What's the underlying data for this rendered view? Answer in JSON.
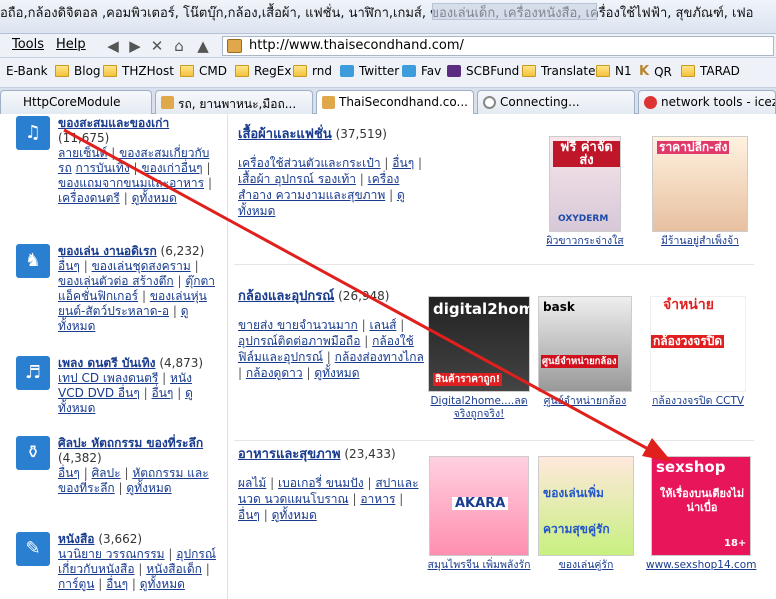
{
  "titlebar": {
    "title": "อถือ,กล้องดิจิตอล ,คอมพิวเตอร์, โน๊ตบุ๊ก,กล้อง,เสื้อผ้า, แฟชั่น, นาฬิกา,เกมส์, ของเล่นเด็ก, เครื่องหนังสือ, เครื่องใช้ไฟฟ้า, สุขภัณฑ์, เฟอ"
  },
  "menu": {
    "tools": "Tools",
    "help": "Help"
  },
  "address": {
    "url": "http://www.thaisecondhand.com/"
  },
  "bookmarks": [
    {
      "label": "E-Bank",
      "icon": "folder-icon"
    },
    {
      "label": "Blog",
      "icon": "folder-icon"
    },
    {
      "label": "THZHost",
      "icon": "folder-icon"
    },
    {
      "label": "CMD",
      "icon": "folder-icon"
    },
    {
      "label": "RegEx",
      "icon": "folder-icon"
    },
    {
      "label": "rnd",
      "icon": "folder-icon"
    },
    {
      "label": "Twitter",
      "icon": "twitter-icon"
    },
    {
      "label": "Fav",
      "icon": "bird-icon"
    },
    {
      "label": "SCBFund",
      "icon": "scb-icon"
    },
    {
      "label": "Translate",
      "icon": "folder-icon"
    },
    {
      "label": "N1",
      "icon": "folder-icon"
    },
    {
      "label": "QR",
      "icon": "k-icon"
    },
    {
      "label": "TARAD",
      "icon": "folder-icon"
    }
  ],
  "tabs": [
    {
      "label": "HttpCoreModule"
    },
    {
      "label": "รถ, ยานพาหนะ,มือถ..."
    },
    {
      "label": "ThaiSecondhand.co..."
    },
    {
      "label": "Connecting..."
    },
    {
      "label": "network tools - icez"
    }
  ],
  "categories": [
    {
      "title": "ของสะสมและของเก่า",
      "count": "(11,675)",
      "links": [
        "ลายเซ็นต์",
        "ของสะสมเกี่ยวกับรถ",
        "การบันเทิง",
        "ของเก่าอื่นๆ",
        "ของแถมจากขนมและอาหาร",
        "เครื่องดนตรี",
        "ดูทั้งหมด"
      ]
    },
    {
      "title": "ของเล่น งานอดิเรก",
      "count": "(6,232)",
      "links": [
        "อื่นๆ",
        "ของเล่นชุดสงคราม",
        "ของเล่นตัวต่อ สร้างตึก",
        "ตุ๊กตาแอ็คชั่นฟิกเกอร์",
        "ของเล่นหุ่นยนต์-สัตว์ประหลาด-อ",
        "ดูทั้งหมด"
      ]
    },
    {
      "title": "เพลง ดนตรี บันเทิง",
      "count": "(4,873)",
      "links": [
        "เทป CD เพลงดนตรี",
        "หนัง VCD DVD อื่นๆ",
        "อื่นๆ",
        "ดูทั้งหมด"
      ]
    },
    {
      "title": "ศิลปะ หัตถกรรม ของที่ระลึก",
      "count": "(4,382)",
      "links": [
        "อื่นๆ",
        "ศิลปะ",
        "หัตถกรรม และของที่ระลึก",
        "ดูทั้งหมด"
      ]
    },
    {
      "title": "หนังสือ",
      "count": "(3,662)",
      "links": [
        "นวนิยาย วรรณกรรม",
        "อุปกรณ์เกี่ยวกับหนังสือ",
        "หนังสือเด็ก",
        "การ์ตูน",
        "อื่นๆ",
        "ดูทั้งหมด"
      ]
    }
  ],
  "sections": [
    {
      "title": "เสื้อผ้าและแฟชั่น",
      "count": "(37,519)",
      "links": [
        "เครื่องใช้ส่วนตัวและกระเป๋า",
        "อื่นๆ",
        "เสื้อผ้า อุปกรณ์ รองเท้า",
        "เครื่องสำอาง ความงามและสุขภาพ",
        "ดูทั้งหมด"
      ]
    },
    {
      "title": "กล้องและอุปกรณ์",
      "count": "(26,948)",
      "links": [
        "ขายส่ง ขายจำนวนมาก",
        "เลนส์",
        "อุปกรณ์ติดต่อภาพมือถือ",
        "กล้องใช้ฟิล์มและอุปกรณ์",
        "กล้องส่องทางไกล",
        "กล้องดูดาว",
        "ดูทั้งหมด"
      ]
    },
    {
      "title": "อาหารและสุขภาพ",
      "count": "(23,433)",
      "links": [
        "ผลไม้",
        "เบอเกอรี่ ขนมปัง",
        "สปาและนวด นวดแผนโบราณ",
        "อาหาร",
        "อื่นๆ",
        "ดูทั้งหมด"
      ]
    }
  ],
  "thumbs": [
    {
      "caption": "ผิวขาวกระจ่างใส",
      "text": "ฟรี ค่าจัดส่ง",
      "sub": "OXYDERM"
    },
    {
      "caption": "มีร้านอยู่สำเพ็งจ้า",
      "text": "ราคาปลีก-ส่ง"
    },
    {
      "caption": "Digital2home....ลดจริงถูกจริง!",
      "text": "digital2home",
      "sub": "สินค้าราคาถูก!"
    },
    {
      "caption": "ศูนย์จำหน่ายกล้อง",
      "text": "bask",
      "sub": "ศูนย์จำหน่ายกล้อง"
    },
    {
      "caption": "กล้องวงจรปิด CCTV",
      "text": "จำหน่าย",
      "sub": "กล้องวงจรปิด"
    },
    {
      "caption": "สมุนไพรจีน เพิ่มพลังรัก",
      "text": "AKARA"
    },
    {
      "caption": "ของเล่นคู่รัก",
      "text": "ของเล่นเพิ่ม",
      "sub": "ความสุขคู่รัก"
    },
    {
      "caption": "www.sexshop14.com",
      "text": "sexshop",
      "sub": "ให้เรื่องบนเตียงไม่น่าเบื่อ",
      "badge": "18+"
    }
  ],
  "colors": {
    "link": "#1a3c8e",
    "arrow": "#e0201c",
    "sexshop_bg": "#e8155a",
    "blue_text": "#2255cc"
  }
}
